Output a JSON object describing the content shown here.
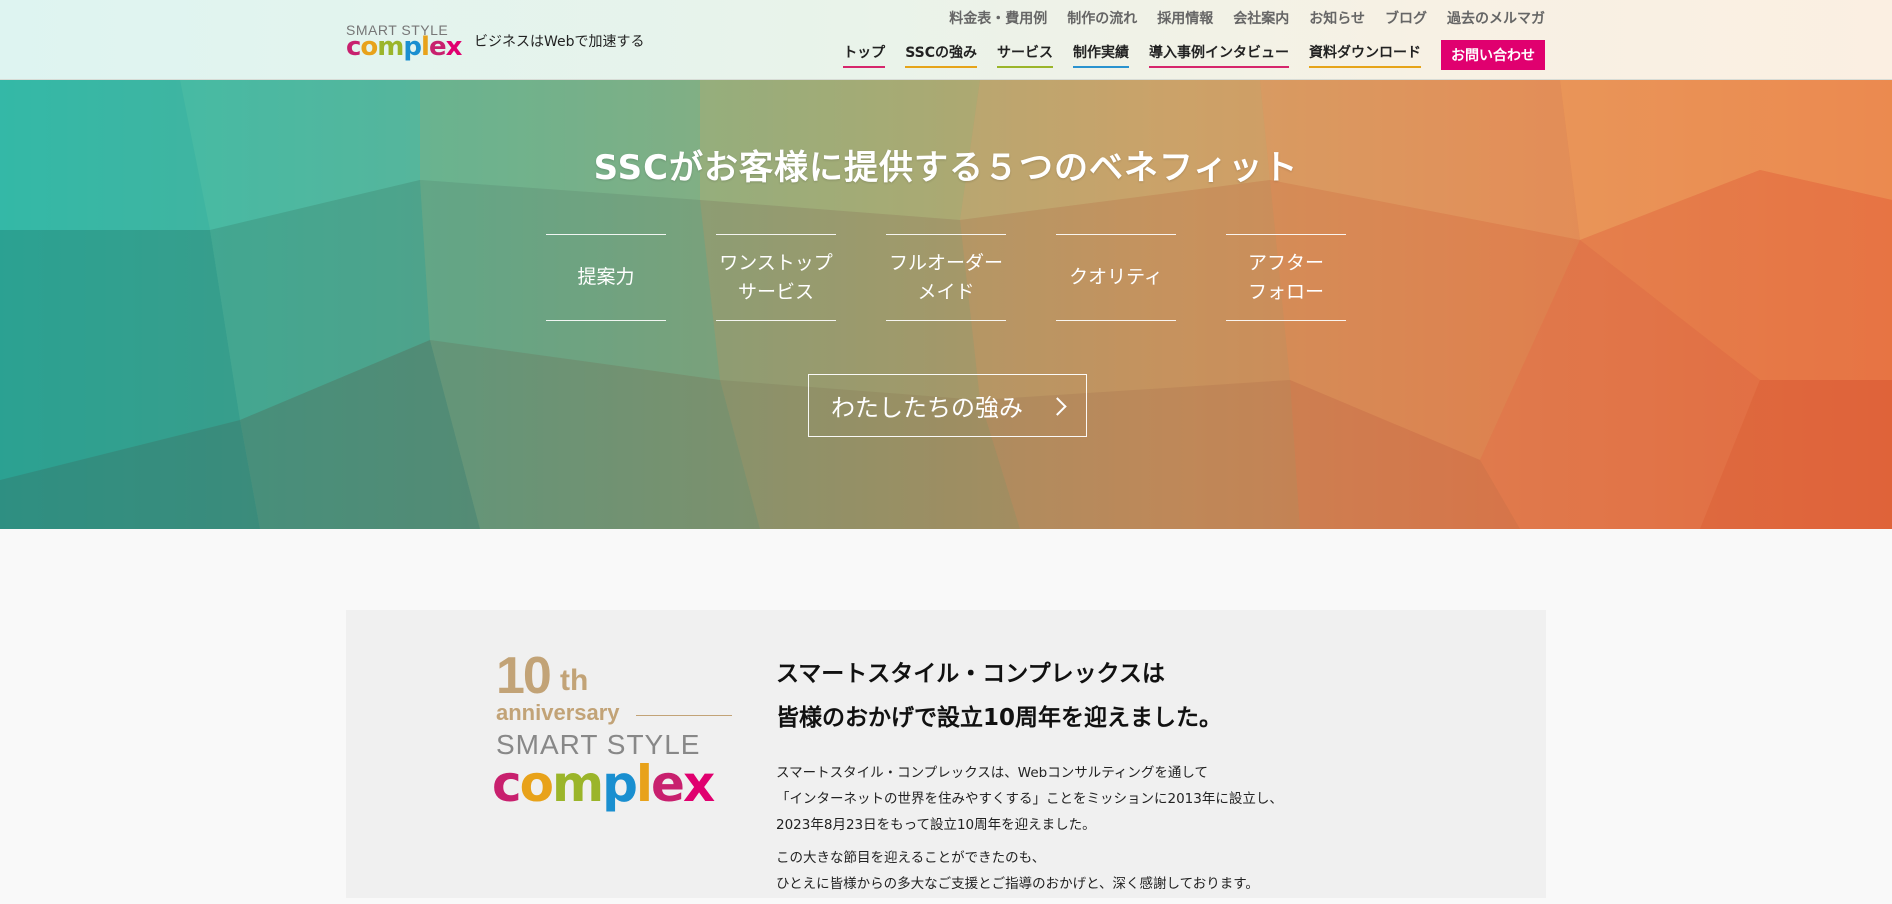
{
  "header": {
    "logo_top": "SMART STYLE",
    "logo_main": "complex",
    "tagline": "ビジネスはWebで加速する",
    "subnav": [
      "料金表・費用例",
      "制作の流れ",
      "採用情報",
      "会社案内",
      "お知らせ",
      "ブログ",
      "過去のメルマガ"
    ],
    "mainnav": [
      {
        "label": "トップ",
        "color": "#d6266c"
      },
      {
        "label": "SSCの強み",
        "color": "#e6a419"
      },
      {
        "label": "サービス",
        "color": "#9bb52a"
      },
      {
        "label": "制作実績",
        "color": "#2a93cf"
      },
      {
        "label": "導入事例インタビュー",
        "color": "#d6266c"
      },
      {
        "label": "資料ダウンロード",
        "color": "#e6a419"
      }
    ],
    "contact_label": "お問い合わせ",
    "contact_color": "#e0006f"
  },
  "hero": {
    "title": "SSCがお客様に提供する５つのベネフィット",
    "benefits": [
      "提案力",
      "ワンストップ\nサービス",
      "フルオーダー\nメイド",
      "クオリティ",
      "アフター\nフォロー"
    ],
    "button_label": "わたしたちの強み"
  },
  "anniversary": {
    "number": "10",
    "suffix": "th",
    "word": "anniversary",
    "brand_top": "SMART STYLE",
    "brand_main": "complex"
  },
  "content": {
    "lead_line1": "スマートスタイル・コンプレックスは",
    "lead_line2": "皆様のおかげで設立10周年を迎えました。",
    "para1_line1": "スマートスタイル・コンプレックスは、Webコンサルティングを通して",
    "para1_line2": "「インターネットの世界を住みやすくする」ことをミッションに2013年に設立し、",
    "para1_line3": "2023年8月23日をもって設立10周年を迎えました。",
    "para2_line1": "この大きな節目を迎えることができたのも、",
    "para2_line2": "ひとえに皆様からの多大なご支援とご指導のおかげと、深く感謝しております。"
  },
  "colors": {
    "brand_magenta": "#e0006f",
    "gold": "#c2a377"
  }
}
